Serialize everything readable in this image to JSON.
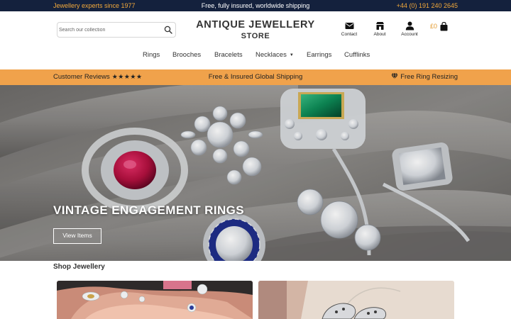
{
  "topbar": {
    "left_text": "Jewellery experts since 1977",
    "center_text": "Free, fully insured, worldwide shipping",
    "phone": "+44 (0) 191 240 2645"
  },
  "search": {
    "placeholder": "Search our collection",
    "icon": "search-icon"
  },
  "logo": {
    "line1": "ANTIQUE JEWELLERY",
    "line2": "STORE"
  },
  "header_icons": [
    {
      "label": "Contact",
      "icon": "envelope-icon"
    },
    {
      "label": "About",
      "icon": "store-icon"
    },
    {
      "label": "Account",
      "icon": "user-icon"
    }
  ],
  "cart": {
    "amount": "£0",
    "icon": "shopping-bag-icon"
  },
  "nav": {
    "items": [
      "Rings",
      "Brooches",
      "Bracelets",
      "Necklaces",
      "Earrings",
      "Cufflinks"
    ],
    "dropdown_caret": "▼"
  },
  "usp_strip": {
    "reviews_label": "Customer Reviews",
    "stars": "★★★★★",
    "shipping_label": "Free & Insured Global Shipping",
    "resizing_label": "Free Ring Resizing",
    "resizing_icon": "diamond-icon"
  },
  "hero": {
    "title": "VINTAGE ENGAGEMENT RINGS",
    "button_label": "View Items"
  },
  "shop": {
    "section_title": "Shop Jewellery"
  },
  "colors": {
    "topbar_bg": "#14213d",
    "accent_orange": "#f0a24b",
    "topbar_accent_text": "#f2a93b"
  }
}
